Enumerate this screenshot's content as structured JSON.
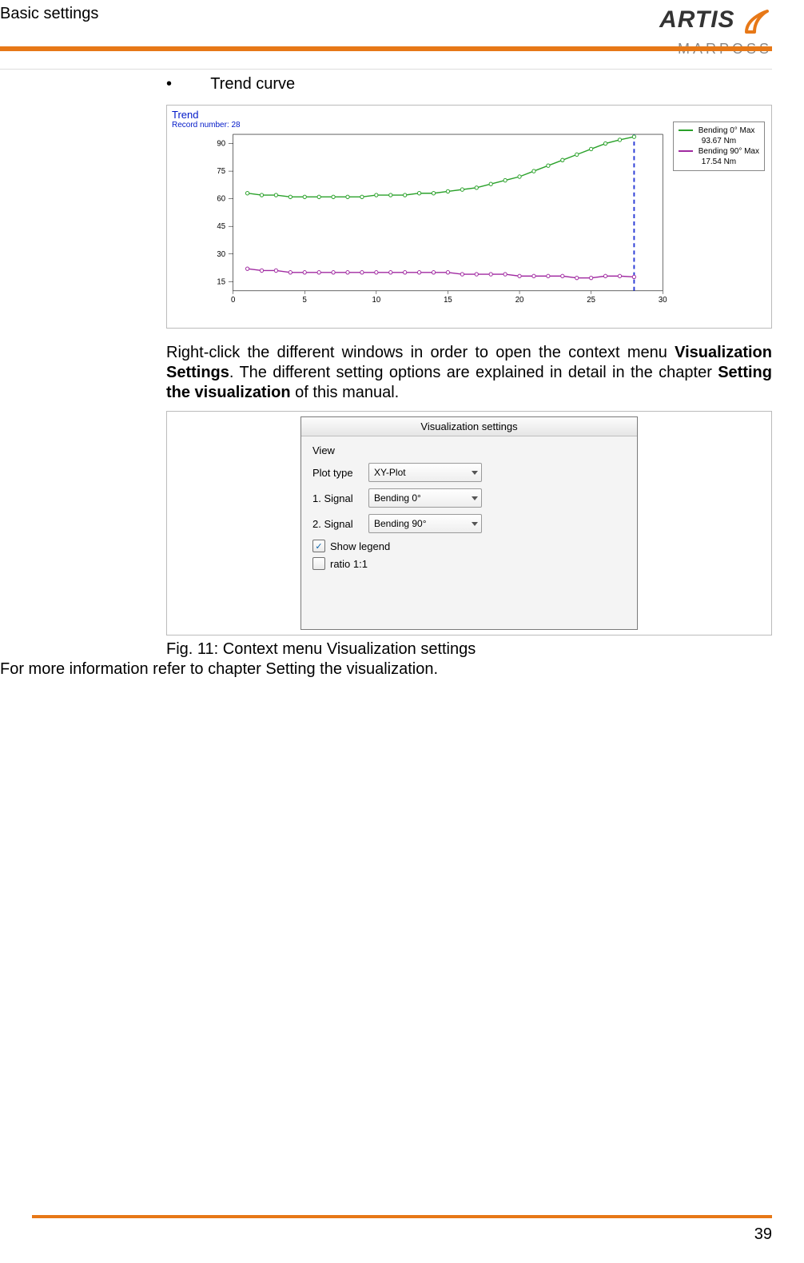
{
  "header": {
    "section_title": "Basic settings",
    "logo_top": "ARTIS",
    "logo_bottom": "MARPOSS"
  },
  "bullet": {
    "marker": "•",
    "text": "Trend curve"
  },
  "chart_data": {
    "type": "line",
    "title": "Trend",
    "subtitle": "Record number: 28",
    "xlabel": "",
    "ylabel": "",
    "xlim": [
      0,
      30
    ],
    "ylim": [
      10,
      95
    ],
    "xticks": [
      0,
      5,
      10,
      15,
      20,
      25,
      30
    ],
    "yticks": [
      15,
      30,
      45,
      60,
      75,
      90
    ],
    "cursor_x": 28,
    "series": [
      {
        "name": "Bending 0° Max",
        "value_label": "93.67 Nm",
        "color": "#2aa12a",
        "x": [
          1,
          2,
          3,
          4,
          5,
          6,
          7,
          8,
          9,
          10,
          11,
          12,
          13,
          14,
          15,
          16,
          17,
          18,
          19,
          20,
          21,
          22,
          23,
          24,
          25,
          26,
          27,
          28
        ],
        "y": [
          63,
          62,
          62,
          61,
          61,
          61,
          61,
          61,
          61,
          62,
          62,
          62,
          63,
          63,
          64,
          65,
          66,
          68,
          70,
          72,
          75,
          78,
          81,
          84,
          87,
          90,
          92,
          93.67
        ]
      },
      {
        "name": "Bending 90° Max",
        "value_label": "17.54 Nm",
        "color": "#a02aa1",
        "x": [
          1,
          2,
          3,
          4,
          5,
          6,
          7,
          8,
          9,
          10,
          11,
          12,
          13,
          14,
          15,
          16,
          17,
          18,
          19,
          20,
          21,
          22,
          23,
          24,
          25,
          26,
          27,
          28
        ],
        "y": [
          22,
          21,
          21,
          20,
          20,
          20,
          20,
          20,
          20,
          20,
          20,
          20,
          20,
          20,
          20,
          19,
          19,
          19,
          19,
          18,
          18,
          18,
          18,
          17,
          17,
          18,
          18,
          17.54
        ]
      }
    ]
  },
  "paragraph": {
    "t1": "Right-click the different windows in order to open the context menu ",
    "b1": "Visualization Settings",
    "t2": ". The different setting options are explained in detail in the chapter ",
    "b2": "Setting the visualization",
    "t3": " of this manual."
  },
  "dialog": {
    "title": "Visualization settings",
    "group": "View",
    "rows": {
      "plot_type": {
        "label": "Plot type",
        "value": "XY-Plot"
      },
      "signal1": {
        "label": "1. Signal",
        "value": "Bending 0°"
      },
      "signal2": {
        "label": "2. Signal",
        "value": "Bending 90°"
      }
    },
    "show_legend": {
      "label": "Show legend",
      "checked": true
    },
    "ratio": {
      "label": "ratio 1:1",
      "checked": false
    }
  },
  "fig_caption": "Fig. 11: Context menu Visualization settings",
  "more_info": "For more information refer to chapter Setting the visualization.",
  "page_number": "39"
}
